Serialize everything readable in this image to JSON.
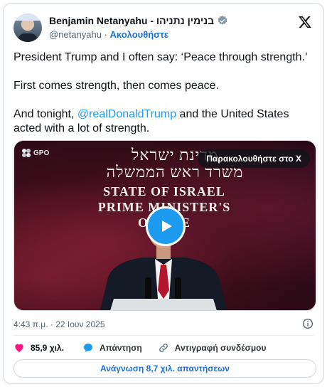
{
  "header": {
    "display_name": "Benjamin Netanyahu - בנימין נתניהו",
    "handle": "@netanyahu",
    "separator": " · ",
    "follow_label": "Ακολουθήστε"
  },
  "tweet": {
    "paragraphs": [
      "President Trump and I often say: ‘Peace through strength.’",
      "First comes strength, then comes peace."
    ],
    "last_paragraph": {
      "before": "And tonight, ",
      "mention": "@realDonaldTrump",
      "after": " and the United States acted with a lot of strength."
    }
  },
  "media": {
    "gpo_label": "GPO",
    "sign_hebrew_line1": "מדינת ישראל",
    "sign_hebrew_line2": "משרד ראש הממשלה",
    "sign_english_line1": "STATE OF ISRAEL",
    "sign_english_line2": "PRIME MINISTER'S OFFICE",
    "watch_label": "Παρακολουθήστε στο X"
  },
  "timestamp": "4:43 π.μ. · 22 Ιουν 2025",
  "actions": {
    "likes": "85,9 χιλ.",
    "reply_label": "Απάντηση",
    "copy_label": "Αντιγραφή συνδέσμου"
  },
  "read_replies_label": "Ανάγνωση 8,7 χιλ. απαντήσεων",
  "colors": {
    "link": "#1d9bf0",
    "like": "#f91880",
    "verified": "#829aab"
  },
  "icons": [
    "verified-icon",
    "x-logo-icon",
    "play-icon",
    "info-icon",
    "heart-icon",
    "reply-bubble-icon",
    "link-icon"
  ]
}
